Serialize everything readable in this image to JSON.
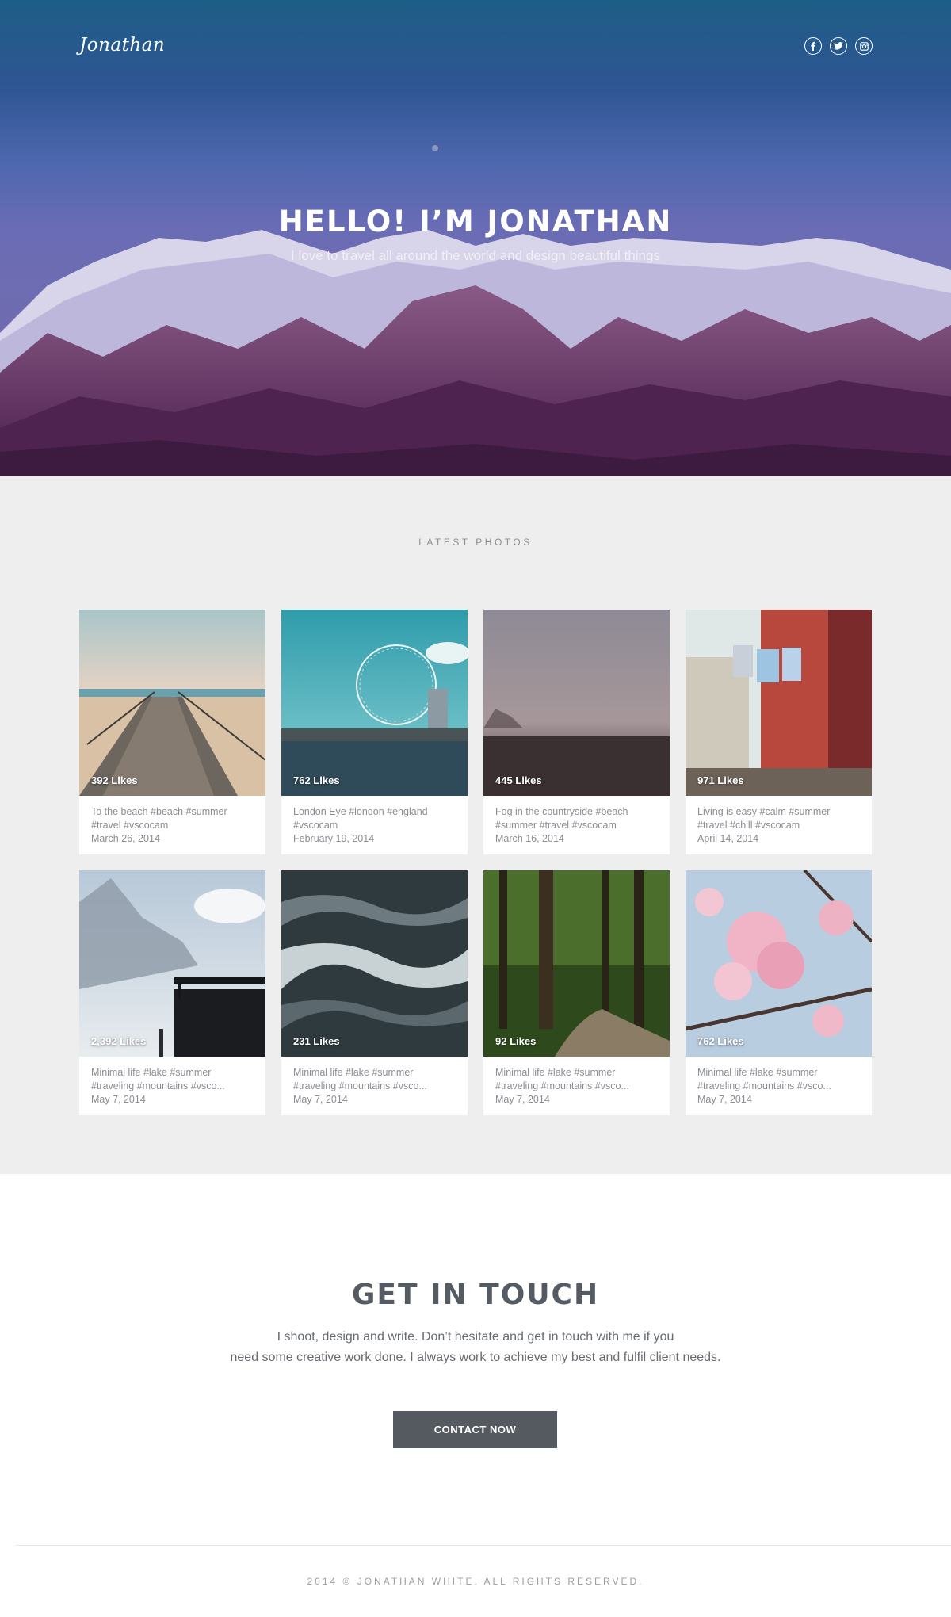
{
  "header": {
    "brand": "Jonathan",
    "social": [
      {
        "icon": "facebook-icon",
        "glyph": "f"
      },
      {
        "icon": "twitter-icon",
        "glyph": "t"
      },
      {
        "icon": "instagram-icon",
        "glyph": "◎"
      }
    ]
  },
  "hero": {
    "title": "HELLO! I’M JONATHAN",
    "subtitle": "I love to travel all around the world and design beautiful things"
  },
  "photos": {
    "section_label": "LATEST PHOTOS",
    "items": [
      {
        "likes": "392 Likes",
        "caption": "To the beach #beach #summer #travel #vscocam",
        "date": "March 26, 2014"
      },
      {
        "likes": "762 Likes",
        "caption": "London Eye #london #england #vscocam",
        "date": "February 19, 2014"
      },
      {
        "likes": "445 Likes",
        "caption": "Fog in the countryside #beach #summer #travel #vscocam",
        "date": "March 16, 2014"
      },
      {
        "likes": "971 Likes",
        "caption": "Living is easy #calm #summer #travel #chill #vscocam",
        "date": "April 14, 2014"
      },
      {
        "likes": "2,392 Likes",
        "caption": "Minimal life #lake #summer #traveling #mountains #vsco...",
        "date": "May 7, 2014"
      },
      {
        "likes": "231 Likes",
        "caption": "Minimal life #lake #summer #traveling #mountains #vsco...",
        "date": "May 7, 2014"
      },
      {
        "likes": "92 Likes",
        "caption": "Minimal life #lake #summer #traveling #mountains #vsco...",
        "date": "May 7, 2014"
      },
      {
        "likes": "762 Likes",
        "caption": "Minimal life #lake #summer #traveling #mountains #vsco...",
        "date": "May 7, 2014"
      }
    ]
  },
  "contact": {
    "title": "GET IN TOUCH",
    "body_line1": "I shoot, design and write. Don’t hesitate and get in touch with me if you",
    "body_line2": "need some creative work done. I always work to achieve my best and fulfil client needs.",
    "button": "CONTACT NOW"
  },
  "footer": {
    "text": "2014 © JONATHAN WHITE. ALL RIGHTS RESERVED."
  },
  "colors": {
    "hero_top": "#1d5e86",
    "hero_purple": "#6a3a70",
    "photos_bg": "#eeeeee",
    "button_bg": "#555a61",
    "heading": "#555b62"
  }
}
